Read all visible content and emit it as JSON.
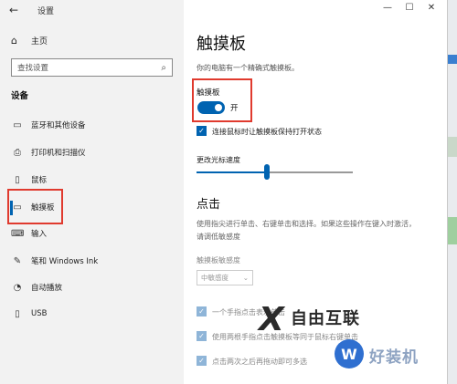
{
  "window": {
    "app_title": "设置",
    "controls": [
      "—",
      "☐",
      "✕"
    ]
  },
  "sidebar": {
    "back_icon": "back-arrow-icon",
    "home_label": "主页",
    "search_placeholder": "查找设置",
    "section": "设备",
    "items": [
      {
        "label": "蓝牙和其他设备",
        "icon": "bluetooth-icon"
      },
      {
        "label": "打印机和扫描仪",
        "icon": "printer-icon"
      },
      {
        "label": "鼠标",
        "icon": "mouse-icon"
      },
      {
        "label": "触摸板",
        "icon": "touchpad-icon",
        "active": true
      },
      {
        "label": "输入",
        "icon": "keyboard-icon"
      },
      {
        "label": "笔和 Windows Ink",
        "icon": "pen-icon"
      },
      {
        "label": "自动播放",
        "icon": "autoplay-icon"
      },
      {
        "label": "USB",
        "icon": "usb-icon"
      }
    ]
  },
  "main": {
    "title": "触摸板",
    "description": "你的电脑有一个精确式触摸板。",
    "toggle_label": "触摸板",
    "toggle_state": "开",
    "toggle_on": true,
    "keep_on_label": "连接鼠标时让触摸板保持打开状态",
    "keep_on_checked": true,
    "cursor_speed_label": "更改光标速度",
    "cursor_speed_fraction": 0.42,
    "tap_heading": "点击",
    "tap_desc_line1": "使用指尖进行单击、右键单击和选择。如果这些操作在键入时激活，",
    "tap_desc_line2": "请调低敏感度",
    "sensitivity_label": "触摸板敏感度",
    "sensitivity_value": "中敏感度",
    "options": [
      {
        "label": "一个手指点击表示单击",
        "checked": true
      },
      {
        "label": "使用两根手指点击触摸板等同于鼠标右键单击",
        "checked": true
      },
      {
        "label": "点击两次之后再拖动即可多选",
        "checked": true
      }
    ]
  },
  "watermark": {
    "mark1": "X",
    "text1": "自由互联",
    "mark2": "W",
    "text2": "好装机"
  },
  "colors": {
    "accent": "#0063b1",
    "highlight": "#e03a2e",
    "sidebar_bg": "#f2f2f2"
  }
}
